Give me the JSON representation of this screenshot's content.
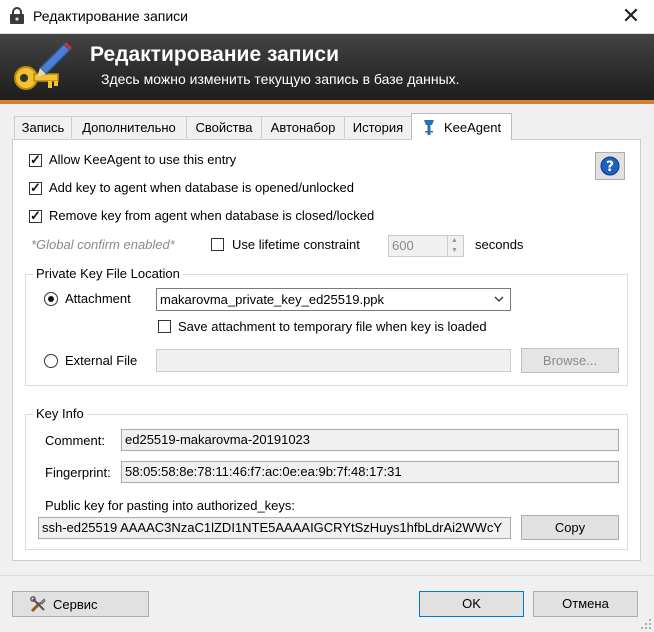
{
  "window": {
    "title": "Редактирование записи",
    "close_glyph": "✕"
  },
  "banner": {
    "title": "Редактирование записи",
    "subtitle": "Здесь можно изменить текущую запись в базе данных."
  },
  "tabs": [
    {
      "label": "Запись"
    },
    {
      "label": "Дополнительно"
    },
    {
      "label": "Свойства"
    },
    {
      "label": "Автонабор"
    },
    {
      "label": "История"
    },
    {
      "label": "KeeAgent"
    }
  ],
  "keeagent": {
    "allow": {
      "label": "Allow KeeAgent to use this entry",
      "checked": true
    },
    "add_key": {
      "label": "Add key to agent when database is opened/unlocked",
      "checked": true
    },
    "remove_key": {
      "label": "Remove key from agent when database is closed/locked",
      "checked": true
    },
    "global_confirm": "*Global confirm enabled*",
    "lifetime": {
      "label": "Use lifetime constraint",
      "checked": false,
      "value": "600",
      "unit": "seconds"
    },
    "private_key": {
      "legend": "Private Key File Location",
      "attachment_label": "Attachment",
      "attachment_value": "makarovma_private_key_ed25519.ppk",
      "save_temp_label": "Save attachment to temporary file when key is loaded",
      "external_label": "External File",
      "external_value": "",
      "browse_label": "Browse..."
    },
    "key_info": {
      "legend": "Key Info",
      "comment_label": "Comment:",
      "comment_value": "ed25519-makarovma-20191023",
      "fingerprint_label": "Fingerprint:",
      "fingerprint_value": "58:05:58:8e:78:11:46:f7:ac:0e:ea:9b:7f:48:17:31",
      "public_key_label": "Public key for pasting into authorized_keys:",
      "public_key_value": "ssh-ed25519 AAAAC3NzaC1lZDI1NTE5AAAAIGCRYtSzHuys1hfbLdrAi2WWcY",
      "copy_label": "Copy"
    }
  },
  "footer": {
    "service_label": "Сервис",
    "ok_label": "OK",
    "cancel_label": "Отмена"
  },
  "colors": {
    "banner_accent": "#d67f2c",
    "help_blue": "#1f5fbf"
  }
}
